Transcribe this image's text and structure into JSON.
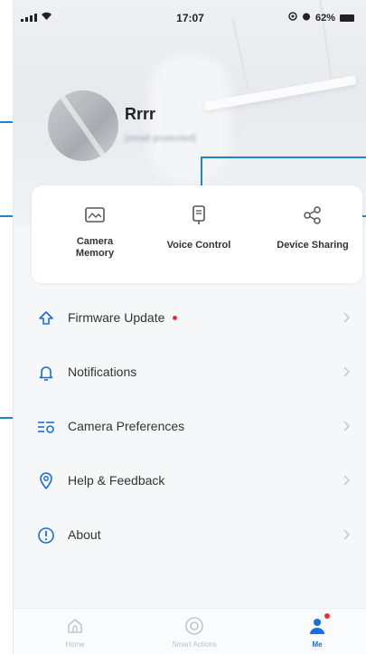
{
  "status_bar": {
    "time": "17:07",
    "battery": "62%"
  },
  "profile": {
    "name": "Rrrr",
    "email": "[email protected]"
  },
  "quick_actions": [
    {
      "label": "Camera Memory",
      "icon": "camera-memory-icon"
    },
    {
      "label": "Voice Control",
      "icon": "voice-control-icon"
    },
    {
      "label": "Device Sharing",
      "icon": "share-icon"
    }
  ],
  "menu": [
    {
      "label": "Firmware Update",
      "icon": "firmware-update-icon",
      "badge": true
    },
    {
      "label": "Notifications",
      "icon": "bell-icon",
      "badge": false
    },
    {
      "label": "Camera Preferences",
      "icon": "camera-preferences-icon",
      "badge": false
    },
    {
      "label": "Help & Feedback",
      "icon": "help-icon",
      "badge": false
    },
    {
      "label": "About",
      "icon": "info-icon",
      "badge": false
    }
  ],
  "tabs": [
    {
      "label": "Home",
      "icon": "home-icon",
      "active": false
    },
    {
      "label": "Smart Actions",
      "icon": "smart-actions-icon",
      "active": false
    },
    {
      "label": "Me",
      "icon": "person-icon",
      "active": true
    }
  ],
  "colors": {
    "accent": "#1b6ed9",
    "callout": "#1f86c8",
    "badge": "#e8303a"
  }
}
